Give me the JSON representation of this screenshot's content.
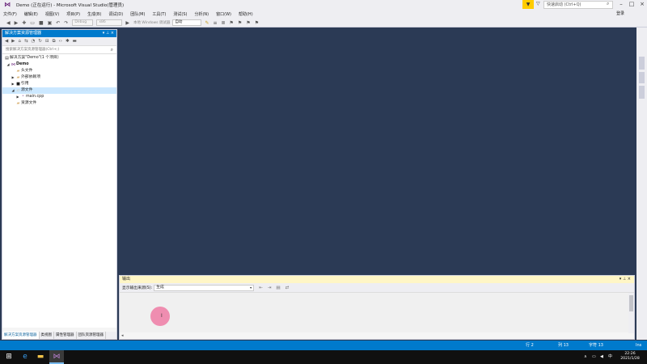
{
  "window": {
    "title": "Demo (正在运行) - Microsoft Visual Studio(管理员)",
    "quick_launch_placeholder": "快速启动 (Ctrl+Q)",
    "login": "登录"
  },
  "menu": [
    "文件(F)",
    "编辑(E)",
    "视图(V)",
    "项目(P)",
    "生成(B)",
    "调试(D)",
    "团队(M)",
    "工具(T)",
    "测试(S)",
    "分析(N)",
    "窗口(W)",
    "帮助(H)"
  ],
  "toolbar": {
    "config": "Debug",
    "platform": "x86",
    "debugger": "本地 Windows 调试器",
    "auto": "自动"
  },
  "solution_explorer": {
    "title": "解决方案资源管理器",
    "search_placeholder": "搜索解决方案资源管理器(Ctrl+;)",
    "tree": [
      {
        "label": "解决方案\"Demo\"(1 个项目)",
        "indent": 0,
        "arrow": "",
        "icon": "solution-icon",
        "bold": false
      },
      {
        "label": "Demo",
        "indent": 1,
        "arrow": "◢",
        "icon": "project-icon",
        "bold": true
      },
      {
        "label": "头文件",
        "indent": 2,
        "arrow": "",
        "icon": "folder-icon",
        "bold": false
      },
      {
        "label": "外部依赖项",
        "indent": 2,
        "arrow": "▶",
        "icon": "folder-icon",
        "bold": false
      },
      {
        "label": "引用",
        "indent": 2,
        "arrow": "▶",
        "icon": "references-icon",
        "bold": false
      },
      {
        "label": "源文件",
        "indent": 2,
        "arrow": "◢",
        "icon": "folder-icon",
        "bold": false,
        "selected": true
      },
      {
        "label": "main.cpp",
        "indent": 3,
        "arrow": "▶",
        "icon": "cpp-file-icon",
        "bold": false
      },
      {
        "label": "资源文件",
        "indent": 2,
        "arrow": "",
        "icon": "folder-icon",
        "bold": false
      }
    ],
    "tabs": [
      "解决方案资源管理器",
      "类视图",
      "属性管理器",
      "团队资源管理器"
    ]
  },
  "output": {
    "title": "输出",
    "source_label": "显示输出来源(S):",
    "source_value": "生成"
  },
  "status": {
    "row": "行 2",
    "col": "列 13",
    "char": "字符 13",
    "ins": "Ins"
  },
  "taskbar": {
    "time": "22:26",
    "date": "2021/1/28",
    "input": "中"
  }
}
